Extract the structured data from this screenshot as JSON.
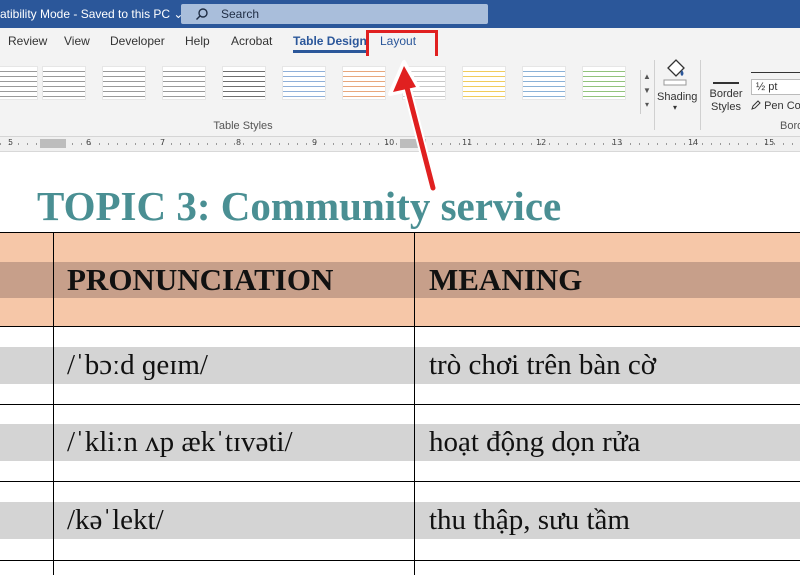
{
  "titlebar": {
    "title": "atibility Mode  -  Saved to this PC  ⌄",
    "search_placeholder": "Search"
  },
  "tabs": [
    {
      "label": "Review"
    },
    {
      "label": "View"
    },
    {
      "label": "Developer"
    },
    {
      "label": "Help"
    },
    {
      "label": "Acrobat"
    },
    {
      "label": "Table Design",
      "active": true
    },
    {
      "label": "Layout",
      "highlighted": true
    }
  ],
  "ribbon": {
    "table_styles_label": "Table Styles",
    "shading_label": "Shading",
    "border_styles_label": "Border Styles",
    "pen_weight": "½ pt",
    "pen_color_label": "Pen Col",
    "borders_label": "Bord",
    "style_accent_colors": [
      "#9a9a9a",
      "#9a9a9a",
      "#9a9a9a",
      "#9a9a9a",
      "#6f6f6f",
      "#8fb0d9",
      "#e8a77c",
      "#c8c8c8",
      "#f1cc5c",
      "#8ab1d8",
      "#92c37c"
    ]
  },
  "ruler": {
    "ticks": [
      "5",
      "6",
      "7",
      "8",
      "9",
      "10",
      "11",
      "12",
      "13",
      "14",
      "15"
    ]
  },
  "document": {
    "topic": "TOPIC 3: Community service",
    "table": {
      "headers": [
        "PRONUNCIATION",
        "MEANING"
      ],
      "rows": [
        {
          "pronunciation": "/ˈbɔːd ɡeɪm/",
          "meaning": "trò chơi trên bàn cờ"
        },
        {
          "pronunciation": "/ˈkliːn ʌp ækˈtɪvəti/",
          "meaning": "hoạt động dọn rửa"
        },
        {
          "pronunciation": "/kəˈlekt/",
          "meaning": "thu thập, sưu tầm"
        }
      ]
    }
  },
  "colors": {
    "titlebar": "#2b579a",
    "accent": "#2b579a",
    "highlight_box": "#e02020",
    "topic_text": "#4a8f93",
    "header_band_light": "#f6c7a8",
    "header_band_dark": "#c79f8a",
    "row_band": "#d4d4d4"
  }
}
